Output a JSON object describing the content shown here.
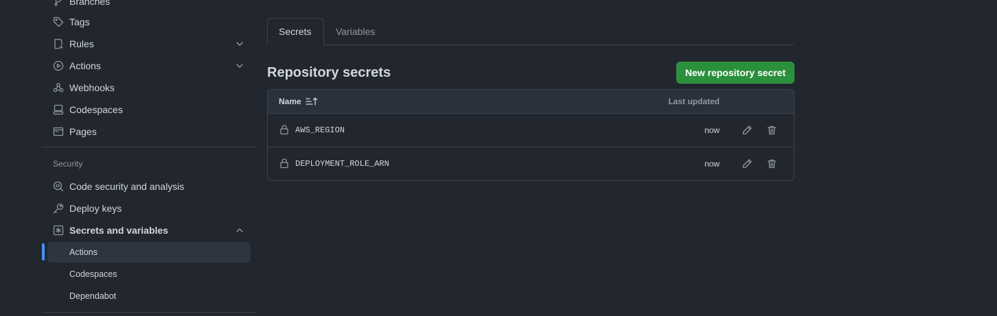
{
  "sidebar": {
    "items": [
      {
        "label": "Branches",
        "icon": "branch-icon"
      },
      {
        "label": "Tags",
        "icon": "tag-icon"
      },
      {
        "label": "Rules",
        "icon": "rules-icon"
      },
      {
        "label": "Actions",
        "icon": "play-icon"
      },
      {
        "label": "Webhooks",
        "icon": "webhook-icon"
      },
      {
        "label": "Codespaces",
        "icon": "codespaces-icon"
      },
      {
        "label": "Pages",
        "icon": "browser-icon"
      }
    ],
    "security_title": "Security",
    "security_items": [
      {
        "label": "Code security and analysis",
        "icon": "codescan-icon"
      },
      {
        "label": "Deploy keys",
        "icon": "key-icon"
      },
      {
        "label": "Secrets and variables",
        "icon": "asterisk-icon"
      }
    ],
    "sub_items": [
      {
        "label": "Actions",
        "active": true
      },
      {
        "label": "Codespaces",
        "active": false
      },
      {
        "label": "Dependabot",
        "active": false
      }
    ]
  },
  "tabs": [
    {
      "label": "Secrets",
      "selected": true
    },
    {
      "label": "Variables",
      "selected": false
    }
  ],
  "main": {
    "heading": "Repository secrets",
    "new_button": "New repository secret",
    "table": {
      "col_name": "Name",
      "col_updated": "Last updated",
      "rows": [
        {
          "name": "AWS_REGION",
          "updated": "now"
        },
        {
          "name": "DEPLOYMENT_ROLE_ARN",
          "updated": "now"
        }
      ]
    }
  },
  "colors": {
    "background": "#22262e",
    "accent": "#4493f8",
    "primary_button": "#29903b",
    "border": "#3d444d"
  }
}
